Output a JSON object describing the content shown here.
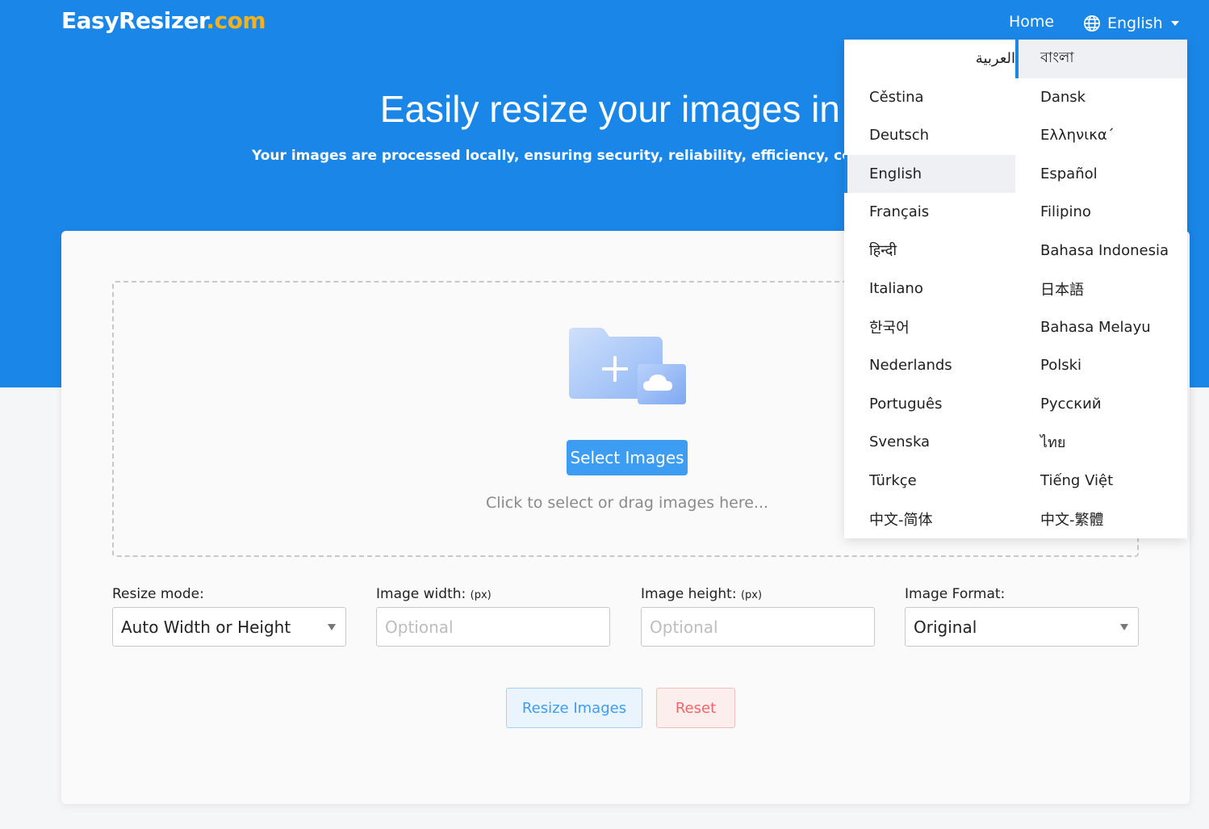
{
  "header": {
    "logo_main": "EasyResizer",
    "logo_tld": ".com",
    "nav_home": "Home",
    "lang_selected": "English"
  },
  "hero": {
    "title": "Easily resize your images in b",
    "subtitle": "Your images are processed locally, ensuring security, reliability, efficiency, convenience,"
  },
  "dropzone": {
    "select_button": "Select Images",
    "hint": "Click to select or drag images here..."
  },
  "options": {
    "resize_mode": {
      "label": "Resize mode:",
      "value": "Auto Width or Height"
    },
    "width": {
      "label": "Image width:",
      "unit": "(px)",
      "placeholder": "Optional"
    },
    "height": {
      "label": "Image height:",
      "unit": "(px)",
      "placeholder": "Optional"
    },
    "format": {
      "label": "Image Format:",
      "value": "Original"
    }
  },
  "actions": {
    "resize": "Resize Images",
    "reset": "Reset"
  },
  "languages": [
    "العربية",
    "বাংলা",
    "Cěstina",
    "Dansk",
    "Deutsch",
    "Ελληνικα´",
    "English",
    "Español",
    "Français",
    "Filipino",
    "हिन्दी",
    "Bahasa Indonesia",
    "Italiano",
    "日本語",
    "한국어",
    "Bahasa Melayu",
    "Nederlands",
    "Polski",
    "Português",
    "Русский",
    "Svenska",
    "ไทย",
    "Türkçe",
    "Tiếng Việt",
    "中文-简体",
    "中文-繁體"
  ],
  "colors": {
    "brand_blue": "#1a87e8",
    "accent_orange": "#f6b11a",
    "button_blue": "#3d9df2",
    "reset_red": "#f36464"
  },
  "icons": {
    "language": "globe-icon",
    "dropdown": "chevron-down-icon",
    "upload": "folder-add-icon"
  }
}
